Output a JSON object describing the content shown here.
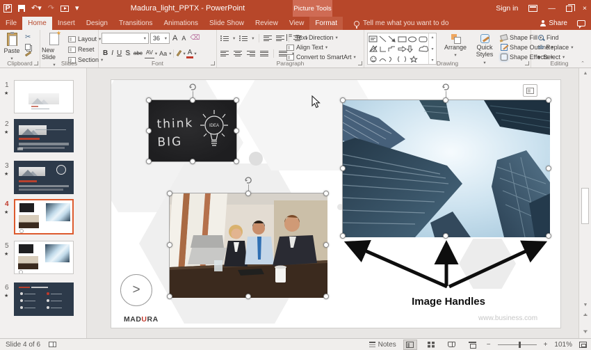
{
  "title_bar": {
    "title": "Madura_light_PPTX - PowerPoint",
    "contextual_group": "Picture Tools",
    "sign_in": "Sign in"
  },
  "tabs": {
    "file": "File",
    "home": "Home",
    "insert": "Insert",
    "design": "Design",
    "transitions": "Transitions",
    "animations": "Animations",
    "slide_show": "Slide Show",
    "review": "Review",
    "view": "View",
    "format": "Format",
    "tell_me": "Tell me what you want to do",
    "share": "Share"
  },
  "ribbon": {
    "clipboard": {
      "group_label": "Clipboard",
      "paste": "Paste"
    },
    "slides": {
      "group_label": "Slides",
      "new_slide": "New Slide",
      "layout": "Layout",
      "reset": "Reset",
      "section": "Section"
    },
    "font": {
      "group_label": "Font",
      "font_name": "",
      "font_size": "36",
      "bold": "B",
      "italic": "I",
      "underline": "U",
      "shadow": "S",
      "strikethrough": "abc",
      "char_spacing": "AV",
      "change_case": "Aa",
      "grow_font": "A",
      "shrink_font": "A",
      "font_color": "A"
    },
    "paragraph": {
      "group_label": "Paragraph",
      "text_direction": "Text Direction",
      "align_text": "Align Text",
      "convert_smartart": "Convert to SmartArt"
    },
    "drawing": {
      "group_label": "Drawing",
      "arrange": "Arrange",
      "quick_styles": "Quick Styles",
      "shape_fill": "Shape Fill",
      "shape_outline": "Shape Outline",
      "shape_effects": "Shape Effects"
    },
    "editing": {
      "group_label": "Editing",
      "find": "Find",
      "replace": "Replace",
      "select": "Select"
    }
  },
  "slide_panel": {
    "slides": [
      {
        "number": "1"
      },
      {
        "number": "2"
      },
      {
        "number": "3"
      },
      {
        "number": "4"
      },
      {
        "number": "5"
      },
      {
        "number": "6"
      }
    ]
  },
  "canvas": {
    "chalkboard_line1": "think",
    "chalkboard_line2": "BIG",
    "bulb_label": "IDEA",
    "logo_prefix": "MAD",
    "logo_accent": "U",
    "logo_suffix": "RA",
    "website": "www.business.com",
    "annotation": "Image Handles",
    "next_button": ">"
  },
  "status_bar": {
    "slide_indicator": "Slide 4 of 6",
    "notes": "Notes",
    "zoom": "101%"
  },
  "colors": {
    "accent": "#B7472A",
    "contextual_tab": "#CF6B54",
    "selected_thumb_border": "#DD5A2D"
  }
}
